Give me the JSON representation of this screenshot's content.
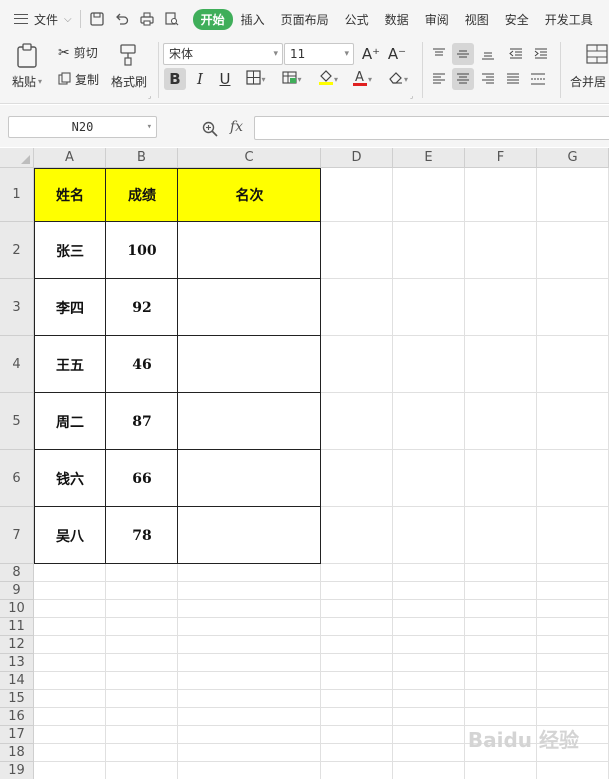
{
  "menu": {
    "file_label": "文件",
    "tabs": [
      "开始",
      "插入",
      "页面布局",
      "公式",
      "数据",
      "审阅",
      "视图",
      "安全",
      "开发工具"
    ],
    "active_tab": "开始"
  },
  "ribbon": {
    "paste_label": "粘贴",
    "cut_label": "剪切",
    "copy_label": "复制",
    "format_painter_label": "格式刷",
    "font_name": "宋体",
    "font_size": "11",
    "grow_font": "A⁺",
    "shrink_font": "A⁻",
    "bold": "B",
    "italic": "I",
    "underline": "U",
    "merge_label": "合并居"
  },
  "formula_bar": {
    "name_box": "N20",
    "fx": "fx",
    "formula": ""
  },
  "sheet": {
    "columns": [
      "A",
      "B",
      "C",
      "D",
      "E",
      "F",
      "G"
    ],
    "rows": [
      "1",
      "2",
      "3",
      "4",
      "5",
      "6",
      "7",
      "8",
      "9",
      "10",
      "11",
      "12",
      "13",
      "14",
      "15",
      "16",
      "17",
      "18",
      "19"
    ],
    "header": [
      "姓名",
      "成绩",
      "名次"
    ],
    "data": [
      [
        "张三",
        "100",
        ""
      ],
      [
        "李四",
        "92",
        ""
      ],
      [
        "王五",
        "46",
        ""
      ],
      [
        "周二",
        "87",
        ""
      ],
      [
        "钱六",
        "66",
        ""
      ],
      [
        "吴八",
        "78",
        ""
      ]
    ],
    "header_fill": "#ffff00"
  },
  "watermark": "Baidu 经验"
}
